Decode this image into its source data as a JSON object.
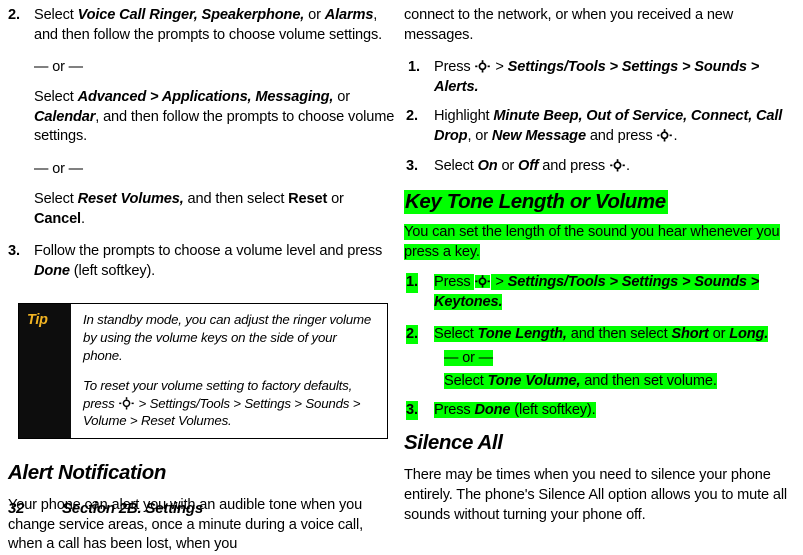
{
  "document": {
    "page_number": "32",
    "section_footer": "Section 2B. Settings",
    "highlight_color": "#00ff00",
    "tip_label_color": "#f0b323"
  },
  "icons": {
    "nav_key": "navigation-key-icon"
  },
  "left_column": {
    "step2": {
      "num": "2.",
      "seg1": "Select ",
      "em1": "Voice Call Ringer, Speakerphone,",
      "seg2": " or ",
      "em2": "Alarms",
      "seg3": ", and then follow the prompts to choose volume settings."
    },
    "or1": "— or —",
    "alt1": {
      "seg1": "Select ",
      "em1": "Advanced > Applications, Messaging,",
      "seg2": " or ",
      "em2": "Calendar",
      "seg3": ", and then follow the prompts to choose volume settings."
    },
    "or2": "— or —",
    "alt2": {
      "seg1": "Select ",
      "em1": "Reset Volumes,",
      "seg2": " and then select ",
      "bold1": "Reset",
      "seg3": " or ",
      "bold2": "Cancel",
      "seg4": "."
    },
    "step3": {
      "num": "3.",
      "seg1": "Follow the prompts to choose a volume level and press ",
      "em1": "Done",
      "seg2": " (left softkey)."
    },
    "tip": {
      "label": "Tip",
      "paragraph1": "In standby mode, you can adjust the ringer volume by using the volume keys on the side of your phone.",
      "paragraph2_before_icon": "To reset your volume setting to factory defaults, press ",
      "paragraph2_after_icon": " > Settings/Tools > Settings > Sounds > Volume > Reset Volumes."
    },
    "alert_notification": {
      "heading": "Alert Notification",
      "body": "Your phone can alert you with an audible tone when you change service areas, once a minute during a voice call, when a call has been lost, when you"
    }
  },
  "right_column": {
    "continued_body": "connect to the network, or when you received a new messages.",
    "alert_steps": {
      "step1": {
        "num": "1.",
        "seg1": "Press ",
        "seg2": " > ",
        "em1": "Settings/Tools > Settings > Sounds > Alerts."
      },
      "step2": {
        "num": "2.",
        "seg1": " Highlight ",
        "em1": "Minute Beep, Out of Service, Connect, Call Drop",
        "seg2": ", or ",
        "em2": "New Message",
        "seg3": " and press ",
        "seg4": "."
      },
      "step3": {
        "num": "3.",
        "seg1": "Select ",
        "em1": "On",
        "seg2": " or ",
        "em2": "Off",
        "seg3": " and press ",
        "seg4": "."
      }
    },
    "key_tone": {
      "heading": "Key Tone Length or Volume",
      "body": "You can set the length of the sound you hear whenever you press a key.",
      "step1": {
        "num": "1.",
        "seg1": "Press ",
        "seg2": " > ",
        "em1": "Settings/Tools > Settings > Sounds > Keytones."
      },
      "step2": {
        "num": "2.",
        "seg1": "Select ",
        "em1": "Tone Length,",
        "seg2": " and then select ",
        "em2": "Short",
        "seg3": " or ",
        "em3": "Long.",
        "or": "— or —",
        "alt_seg1": "Select ",
        "alt_em1": "Tone Volume,",
        "alt_seg2": " and then set volume."
      },
      "step3": {
        "num": "3.",
        "seg1": "Press ",
        "em1": "Done",
        "seg2": " (left softkey)."
      }
    },
    "silence_all": {
      "heading": "Silence All",
      "body": "There may be times when you need to silence your phone entirely. The phone's Silence All option allows you to mute all sounds without turning your phone off."
    }
  }
}
